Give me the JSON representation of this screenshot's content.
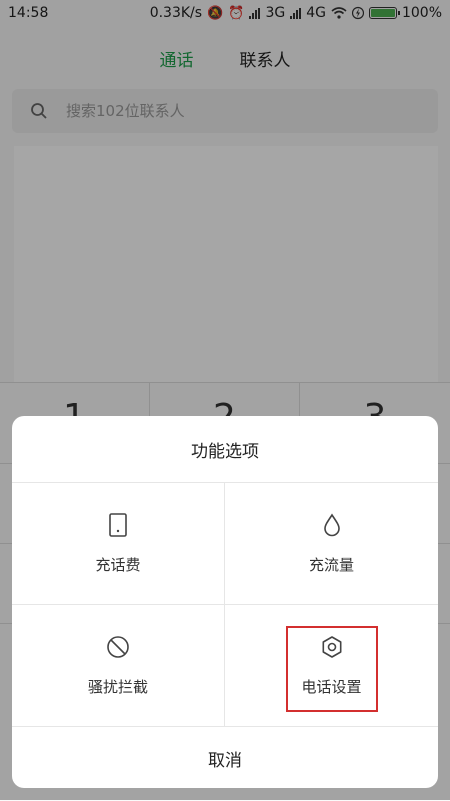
{
  "status_bar": {
    "time": "14:58",
    "speed": "0.33K/s",
    "network_3g": "3G",
    "network_4g": "4G",
    "battery": "100%",
    "battery_level": 1.0
  },
  "tabs": [
    {
      "label": "通话",
      "active": true
    },
    {
      "label": "联系人",
      "active": false
    }
  ],
  "search": {
    "placeholder": "搜索102位联系人",
    "value": ""
  },
  "keypad": {
    "keys": [
      "1",
      "2",
      "3"
    ]
  },
  "dialog": {
    "title": "功能选项",
    "options": [
      {
        "label": "充话费",
        "icon": "phone-icon"
      },
      {
        "label": "充流量",
        "icon": "water-drop-icon"
      },
      {
        "label": "骚扰拦截",
        "icon": "block-icon"
      },
      {
        "label": "电话设置",
        "icon": "gear-icon"
      }
    ],
    "cancel_label": "取消"
  },
  "colors": {
    "accent": "#1d9e4b",
    "highlight": "#d32f2f"
  }
}
